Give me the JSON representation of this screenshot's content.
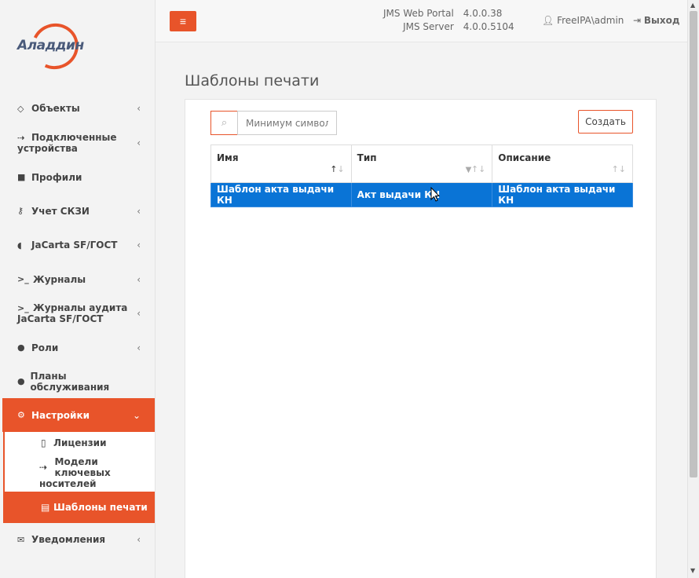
{
  "brand": {
    "logo_text": "Аладдин",
    "accent": "#e8542a",
    "selected": "#0a74d6"
  },
  "sidebar": {
    "items": [
      {
        "icon": "diamond-icon",
        "glyph": "◇",
        "label": "Объекты",
        "has_chevron": true
      },
      {
        "icon": "usb-icon",
        "glyph": "⇢",
        "label": "Подключенные",
        "label2": "устройства",
        "has_chevron": true
      },
      {
        "icon": "folder-icon",
        "glyph": "■",
        "label": "Профили",
        "has_chevron": false
      },
      {
        "icon": "key-icon",
        "glyph": "⚷",
        "label": "Учет СКЗИ",
        "has_chevron": true
      },
      {
        "icon": "shield-icon",
        "glyph": "◖",
        "label": "JaCarta SF/ГОСТ",
        "has_chevron": true
      },
      {
        "icon": "terminal-icon",
        "glyph": ">_",
        "label": "Журналы",
        "has_chevron": true
      },
      {
        "icon": "terminal-icon",
        "glyph": ">_",
        "label": "Журналы аудита",
        "label2": "JaCarta SF/ГОСТ",
        "has_chevron": true
      },
      {
        "icon": "user-circle-icon",
        "glyph": "●",
        "label": "Роли",
        "has_chevron": true
      },
      {
        "icon": "user-circle-icon",
        "glyph": "●",
        "label": "Планы обслуживания",
        "has_chevron": false
      },
      {
        "icon": "gears-icon",
        "glyph": "⚙",
        "label": "Настройки",
        "has_chevron": true,
        "active": true
      }
    ],
    "sub_items": [
      {
        "icon": "file-icon",
        "glyph": "▯",
        "label": "Лицензии"
      },
      {
        "icon": "usb-icon",
        "glyph": "⇢",
        "label": "Модели ключевых",
        "label2": "носителей"
      },
      {
        "icon": "printer-icon",
        "glyph": "▤",
        "label": "Шаблоны печати",
        "active": true
      }
    ],
    "last_item": {
      "icon": "envelope-icon",
      "glyph": "✉",
      "label": "Уведомления",
      "has_chevron": true
    }
  },
  "header": {
    "menu_glyph": "≡",
    "portal_label": "JMS Web Portal",
    "portal_version": "4.0.0.38",
    "server_label": "JMS Server",
    "server_version": "4.0.0.5104",
    "user": "FreeIPA\\admin",
    "logout": "Выход"
  },
  "main": {
    "title": "Шаблоны печати",
    "search_placeholder": "Минимум символов",
    "create_label": "Создать",
    "columns": [
      "Имя",
      "Тип",
      "Описание"
    ],
    "rows": [
      [
        "Шаблон акта выдачи КН",
        "Акт выдачи КН",
        "Шаблон акта выдачи КН"
      ]
    ]
  }
}
